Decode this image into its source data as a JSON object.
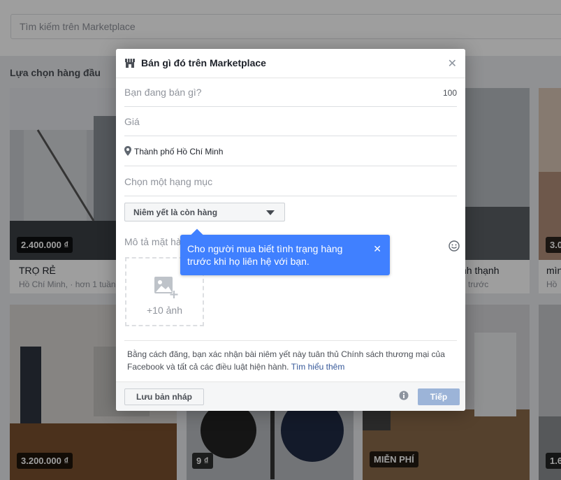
{
  "search": {
    "placeholder": "Tìm kiếm trên Marketplace"
  },
  "section_title": "Lựa chọn hàng đầu",
  "listings": [
    {
      "price": "2.400.000 ₫",
      "title": "TRỌ RẺ",
      "location": "Hồ Chí Minh, · hơn 1 tuần"
    },
    {
      "price": "",
      "title": "nh thạnh",
      "location": "n trước"
    },
    {
      "price": "3.0",
      "title": "mìn",
      "location": "Hồ"
    },
    {
      "price": "3.200.000 ₫",
      "title": "",
      "location": ""
    },
    {
      "price": "9 ₫",
      "title": "",
      "location": ""
    },
    {
      "price": "MIỄN PHÍ",
      "title": "",
      "location": ""
    },
    {
      "price": "1.6",
      "title": "",
      "location": ""
    }
  ],
  "modal": {
    "title": "Bán gì đó trên Marketplace",
    "close_icon": "close-icon",
    "what_selling_placeholder": "Bạn đang bán gì?",
    "char_counter": "100",
    "price_placeholder": "Giá",
    "location": "Thành phố Hồ Chí Minh",
    "category_placeholder": "Chọn một hạng mục",
    "availability_select": "Niêm yết là còn hàng",
    "description_placeholder": "Mô tả mặt hà",
    "photo_count": "+10 ảnh",
    "terms_text": "Bằng cách đăng, bạn xác nhận bài niêm yết này tuân thủ Chính sách thương mại của Facebook và tất cả các điều luật hiện hành.",
    "terms_link": "Tìm hiểu thêm",
    "save_draft_label": "Lưu bản nháp",
    "next_label": "Tiếp"
  },
  "tooltip": {
    "text": "Cho người mua biết tình trạng hàng trước khi họ liên hệ với bạn.",
    "close_icon": "close-icon"
  },
  "colors": {
    "accent": "#4080ff",
    "next_button_disabled": "#9cb4d8",
    "overlay": "#000000"
  }
}
